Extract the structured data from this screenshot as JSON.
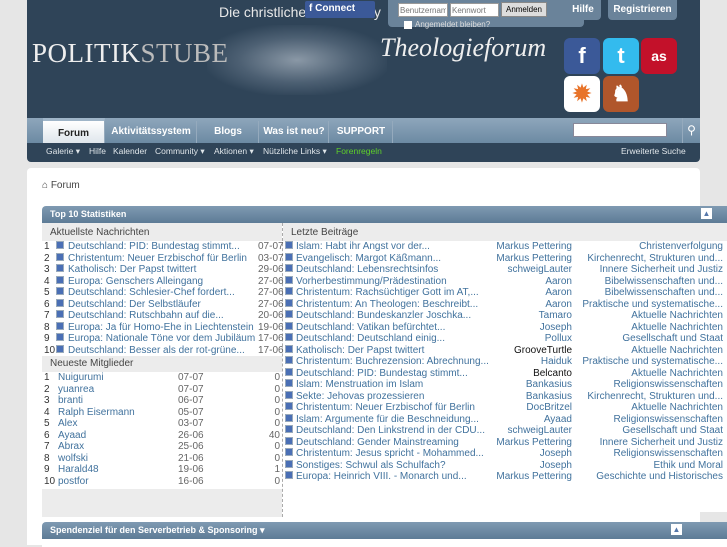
{
  "header": {
    "slogan": "Die christliche Community",
    "fb_connect": "Connect",
    "username_placeholder": "Benutzername",
    "password_placeholder": "Kennwort",
    "login_button": "Anmelden",
    "remember": "Angemeldet bleiben?",
    "help": "Hilfe",
    "register": "Registrieren",
    "logo_main": "POLITIK",
    "logo_sub": "STUBE",
    "logo_theo": "Theologieforum",
    "social": [
      "facebook",
      "twitter",
      "lastfm",
      "badge",
      "game"
    ]
  },
  "nav": {
    "tabs": [
      "Forum",
      "Aktivitätssystem",
      "Blogs",
      "Was ist neu?",
      "SUPPORT"
    ],
    "sub": [
      "Galerie ▾",
      "Hilfe",
      "Kalender",
      "Community ▾",
      "Aktionen ▾",
      "Nützliche Links ▾",
      "Forenregeln"
    ],
    "advanced_search": "Erweiterte Suche",
    "forenregeln_color": "#5fd02a"
  },
  "breadcrumb": "Forum",
  "stats": {
    "title": "Top 10 Statistiken",
    "news_title": "Aktuellste Nachrichten",
    "news": [
      {
        "t": "Deutschland: PID: Bundestag stimmt...",
        "d": "07-07"
      },
      {
        "t": "Christentum: Neuer Erzbischof für Berlin",
        "d": "03-07"
      },
      {
        "t": "Katholisch: Der Papst twittert",
        "d": "29-06"
      },
      {
        "t": "Europa: Genschers Alleingang",
        "d": "27-06"
      },
      {
        "t": "Deutschland: Schlesier-Chef fordert...",
        "d": "27-06"
      },
      {
        "t": "Deutschland: Der Selbstläufer",
        "d": "27-06"
      },
      {
        "t": "Deutschland: Rutschbahn auf die...",
        "d": "20-06"
      },
      {
        "t": "Europa: Ja für Homo-Ehe in Liechtenstein",
        "d": "19-06"
      },
      {
        "t": "Europa: Nationale Töne vor dem Jubiläum",
        "d": "17-06"
      },
      {
        "t": "Deutschland: Besser als der rot-grüne...",
        "d": "17-06"
      }
    ],
    "members_title": "Neueste Mitglieder",
    "members": [
      {
        "n": "Nuigurumi",
        "d": "07-07",
        "c": "0"
      },
      {
        "n": "yuanrea",
        "d": "07-07",
        "c": "0"
      },
      {
        "n": "branti",
        "d": "06-07",
        "c": "0"
      },
      {
        "n": "Ralph Eisermann",
        "d": "05-07",
        "c": "0"
      },
      {
        "n": "Alex",
        "d": "03-07",
        "c": "0"
      },
      {
        "n": "Ayaad",
        "d": "26-06",
        "c": "40"
      },
      {
        "n": "Abrax",
        "d": "25-06",
        "c": "0"
      },
      {
        "n": "wolfski",
        "d": "21-06",
        "c": "0"
      },
      {
        "n": "Harald48",
        "d": "19-06",
        "c": "1"
      },
      {
        "n": "postfor",
        "d": "16-06",
        "c": "0"
      }
    ],
    "posts_title": "Letzte Beiträge",
    "posts": [
      {
        "t": "Islam: Habt ihr Angst vor der...",
        "u": "Markus Pettering",
        "f": "Christenverfolgung"
      },
      {
        "t": "Evangelisch: Margot Käßmann...",
        "u": "Markus Pettering",
        "f": "Kirchenrecht, Strukturen und..."
      },
      {
        "t": "Deutschland: Lebensrechtsinfos",
        "u": "schweigLauter",
        "f": "Innere Sicherheit und Justiz"
      },
      {
        "t": "Vorherbestimmung/Prädestination",
        "u": "Aaron",
        "f": "Bibelwissenschaften und..."
      },
      {
        "t": "Christentum: Rachsüchtiger Gott im AT,...",
        "u": "Aaron",
        "f": "Bibelwissenschaften und..."
      },
      {
        "t": "Christentum: An Theologen: Beschreibt...",
        "u": "Aaron",
        "f": "Praktische und systematische..."
      },
      {
        "t": "Deutschland: Bundeskanzler Joschka...",
        "u": "Tamaro",
        "f": "Aktuelle Nachrichten"
      },
      {
        "t": "Deutschland: Vatikan befürchtet...",
        "u": "Joseph",
        "f": "Aktuelle Nachrichten"
      },
      {
        "t": "Deutschland: Deutschland einig...",
        "u": "Pollux",
        "f": "Gesellschaft und Staat"
      },
      {
        "t": "Katholisch: Der Papst twittert",
        "u": "GrooveTurtle",
        "f": "Aktuelle Nachrichten"
      },
      {
        "t": "Christentum: Buchrezension: Abrechnung...",
        "u": "Haiduk",
        "f": "Praktische und systematische..."
      },
      {
        "t": "Deutschland: PID: Bundestag stimmt...",
        "u": "Belcanto",
        "f": "Aktuelle Nachrichten"
      },
      {
        "t": "Islam: Menstruation im Islam",
        "u": "Bankasius",
        "f": "Religionswissenschaften"
      },
      {
        "t": "Sekte: Jehovas prozessieren",
        "u": "Bankasius",
        "f": "Kirchenrecht, Strukturen und..."
      },
      {
        "t": "Christentum: Neuer Erzbischof für Berlin",
        "u": "DocBritzel",
        "f": "Aktuelle Nachrichten"
      },
      {
        "t": "Islam: Argumente für die Beschneidung...",
        "u": "Ayaad",
        "f": "Religionswissenschaften"
      },
      {
        "t": "Deutschland: Den Linkstrend in der CDU...",
        "u": "schweigLauter",
        "f": "Gesellschaft und Staat"
      },
      {
        "t": "Deutschland: Gender Mainstreaming",
        "u": "Markus Pettering",
        "f": "Innere Sicherheit und Justiz"
      },
      {
        "t": "Christentum: Jesus spricht - Mohammed...",
        "u": "Joseph",
        "f": "Religionswissenschaften"
      },
      {
        "t": "Sonstiges: Schwul als Schulfach?",
        "u": "Joseph",
        "f": "Ethik und Moral"
      },
      {
        "t": "Europa: Heinrich VIII. - Monarch und...",
        "u": "Markus Pettering",
        "f": "Geschichte und Historisches"
      }
    ]
  },
  "spend": {
    "title": "Spendenziel für den Serverbetrieb & Sponsoring ▾"
  }
}
